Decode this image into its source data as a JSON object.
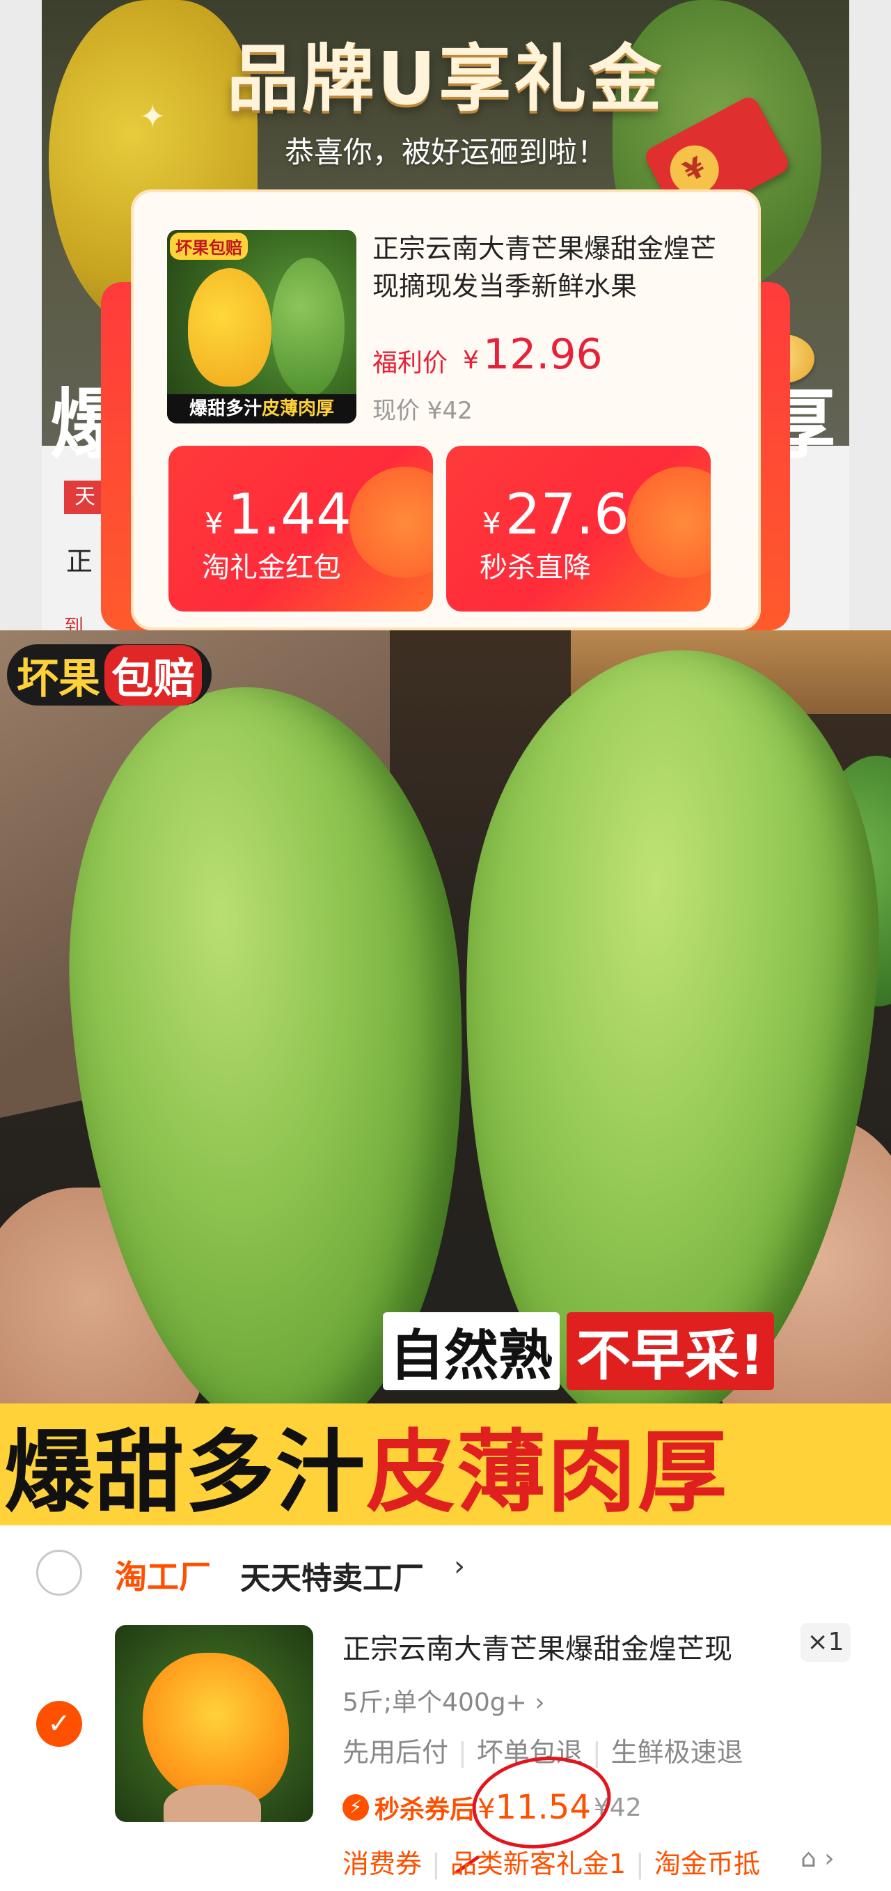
{
  "promo": {
    "title": "品牌U享礼金",
    "subtitle": "恭喜你，被好运砸到啦！",
    "bg_word_left": "爆",
    "bg_word_right": "厚",
    "bg_badge": "天",
    "bg_text_a": "正",
    "bg_text_b": "到",
    "thumb_tag": "坏果包赔",
    "thumb_caption_a": "爆甜多汁",
    "thumb_caption_b": "皮薄肉厚",
    "product_name": "正宗云南大青芒果爆甜金煌芒现摘现发当季新鲜水果",
    "deal_label": "福利价",
    "deal_currency": "¥",
    "deal_price": "12.96",
    "now_price": "现价 ¥42",
    "coupons": [
      {
        "currency": "¥",
        "amount": "1.44",
        "label": "淘礼金红包"
      },
      {
        "currency": "¥",
        "amount": "27.6",
        "label": "秒杀直降"
      }
    ]
  },
  "hero": {
    "badge_a": "坏果",
    "badge_b": "包赔",
    "slogan_a1": "自然熟",
    "slogan_a2": "不早采!",
    "slogan_b1": "爆甜多汁",
    "slogan_b2": "皮薄肉厚"
  },
  "cart": {
    "store_brand": "淘工厂",
    "store_name": "天天特卖工厂",
    "store_arrow": "›",
    "item_title": "正宗云南大青芒果爆甜金煌芒现",
    "quantity": "×1",
    "sku": "5斤;单个400g+ ›",
    "services": [
      "先用后付",
      "坏单包退",
      "生鲜极速退"
    ],
    "price_label": "秒杀券后",
    "price_currency": "¥",
    "price_value": "11.54",
    "price_old": "¥42",
    "bottom_tags": [
      "消费券",
      "品类新客礼金1",
      "淘金币抵"
    ],
    "more": "⌂ ›"
  },
  "colors": {
    "accent": "#ff5000",
    "deal_red": "#e8213a",
    "coupon_red": "#ff2b3a",
    "slogan_yellow": "#ffd23a"
  }
}
